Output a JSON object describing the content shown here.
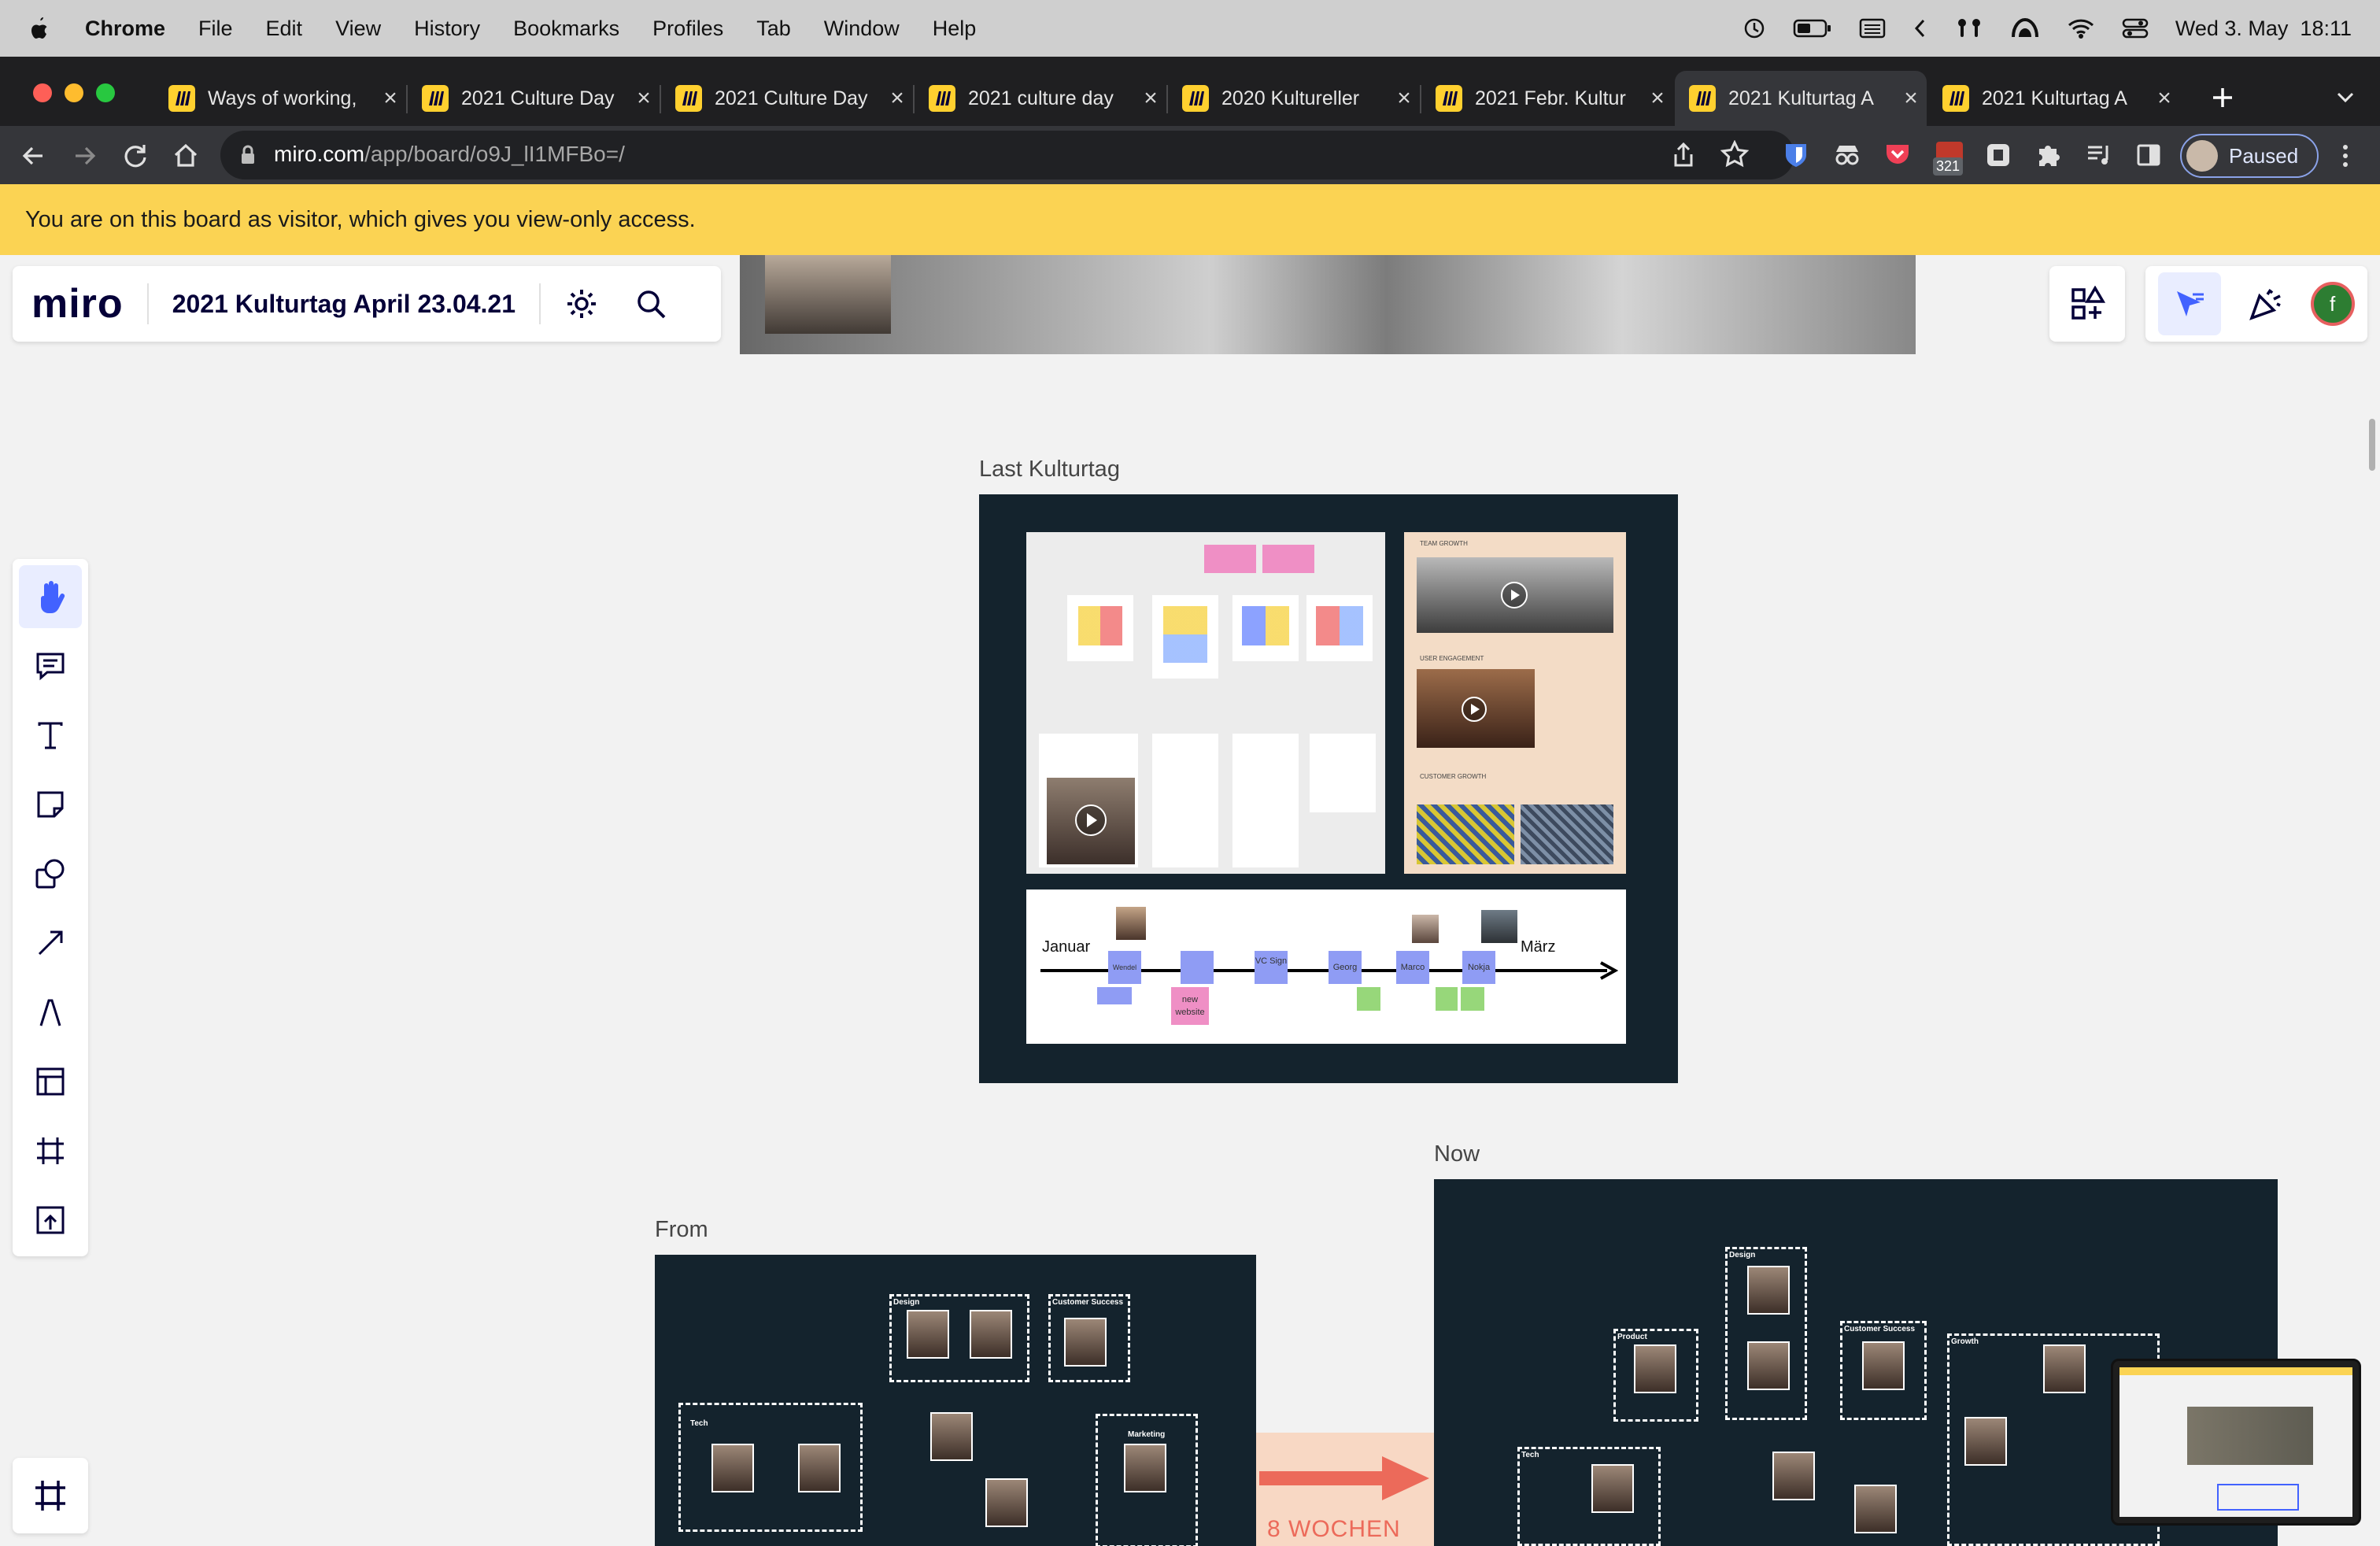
{
  "menubar": {
    "app": "Chrome",
    "items": [
      "File",
      "Edit",
      "View",
      "History",
      "Bookmarks",
      "Profiles",
      "Tab",
      "Window",
      "Help"
    ],
    "clock": "Wed 3. May  18:11"
  },
  "tabs": [
    {
      "label": "Ways of working,"
    },
    {
      "label": "2021 Culture Day"
    },
    {
      "label": "2021 Culture Day"
    },
    {
      "label": "2021 culture day"
    },
    {
      "label": "2020 Kultureller"
    },
    {
      "label": "2021 Febr. Kultur"
    },
    {
      "label": "2021 Kulturtag A",
      "active": true
    },
    {
      "label": "2021 Kulturtag A"
    }
  ],
  "address": {
    "host": "miro.com",
    "path": "/app/board/o9J_lI1MFBo=/"
  },
  "toolbar": {
    "extension_badge": "321",
    "profile_status": "Paused"
  },
  "banner": {
    "text": "You are on this board as visitor, which gives you view-only access."
  },
  "board": {
    "logo": "miro",
    "title": "2021 Kulturtag April 23.04.21",
    "avatar_letter": "f",
    "frames": {
      "last": {
        "label": "Last Kulturtag"
      },
      "from": {
        "label": "From"
      },
      "now": {
        "label": "Now"
      }
    },
    "timeline": {
      "start": "Januar",
      "end": "März",
      "stops": [
        "Wendel",
        "",
        "VC Sign",
        "Georg",
        "Marco",
        "Nokja"
      ],
      "note": "new website"
    },
    "arrow_text": "8 WOCHEN",
    "groups_from": [
      "Design",
      "Customer Success",
      "Tech",
      "Marketing"
    ],
    "groups_now": [
      "Design",
      "Product",
      "Customer Success",
      "Growth",
      "Tech"
    ],
    "growth_panel": [
      "TEAM GROWTH",
      "USER ENGAGEMENT",
      "CUSTOMER GROWTH"
    ]
  },
  "colors": {
    "accent": "#4262ff",
    "frame": "#14232d",
    "banner": "#fbd353",
    "chrome_yellow": "#ffd02f"
  }
}
